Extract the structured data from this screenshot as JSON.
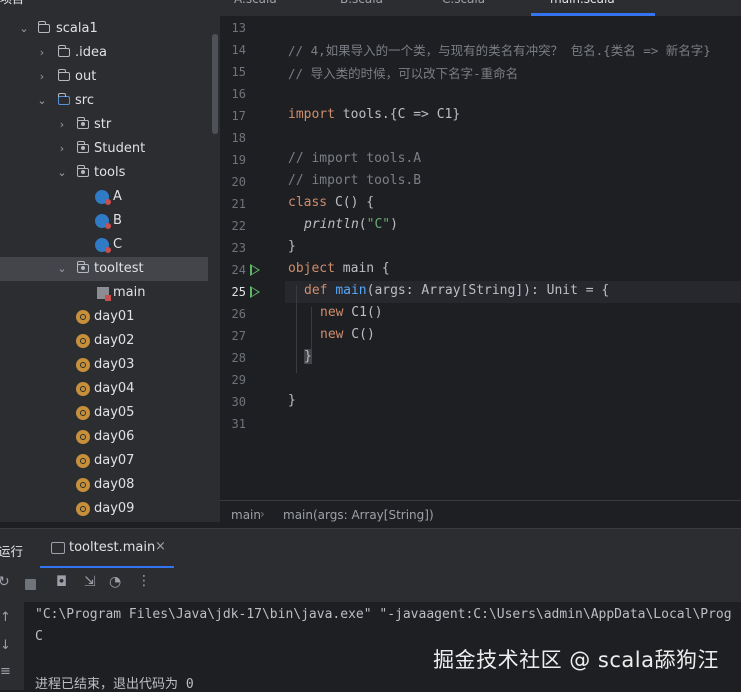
{
  "project_tree": {
    "header_partial": "项目",
    "items": [
      {
        "label": "scala1",
        "type": "folder",
        "expanded": true
      },
      {
        "label": ".idea",
        "type": "folder",
        "expanded": false
      },
      {
        "label": "out",
        "type": "folder",
        "expanded": false
      },
      {
        "label": "src",
        "type": "folder",
        "expanded": true
      },
      {
        "label": "str",
        "type": "package",
        "expanded": false
      },
      {
        "label": "Student",
        "type": "package",
        "expanded": false
      },
      {
        "label": "tools",
        "type": "package",
        "expanded": true
      },
      {
        "label": "A",
        "type": "scala-class"
      },
      {
        "label": "B",
        "type": "scala-class"
      },
      {
        "label": "C",
        "type": "scala-class"
      },
      {
        "label": "tooltest",
        "type": "package",
        "expanded": true
      },
      {
        "label": "main",
        "type": "scala-main"
      },
      {
        "label": "day01",
        "type": "object"
      },
      {
        "label": "day02",
        "type": "object"
      },
      {
        "label": "day03",
        "type": "object"
      },
      {
        "label": "day04",
        "type": "object"
      },
      {
        "label": "day05",
        "type": "object"
      },
      {
        "label": "day06",
        "type": "object"
      },
      {
        "label": "day07",
        "type": "object"
      },
      {
        "label": "day08",
        "type": "object"
      },
      {
        "label": "day09",
        "type": "object"
      }
    ]
  },
  "editor": {
    "tabs": [
      "A.scala",
      "B.scala",
      "C.scala",
      "main.scala"
    ],
    "active_tab": "main.scala",
    "line_numbers": [
      "13",
      "14",
      "15",
      "16",
      "17",
      "18",
      "19",
      "20",
      "21",
      "22",
      "23",
      "24",
      "25",
      "26",
      "27",
      "28",
      "29",
      "30",
      "31"
    ],
    "current_line": "25",
    "code": {
      "l14": "// 4,如果导入的一个类，与现有的类名有冲突？ 包名.{类名 => 新名字}",
      "l15": "// 导入类的时候，可以改下名字-重命名",
      "l17_kw": "import",
      "l17_rest": " tools.{C => C1}",
      "l19": "// import tools.A",
      "l20": "// import tools.B",
      "l21_kw": "class",
      "l21_rest": " C() {",
      "l22_fn": "println",
      "l22_open": "(",
      "l22_str": "\"C\"",
      "l22_close": ")",
      "l23": "}",
      "l24_kw": "object",
      "l24_rest": " main {",
      "l25_kw": "def",
      "l25_fn": "main",
      "l25_rest": "(args: Array[String]): Unit = {",
      "l26_kw": "new",
      "l26_rest": " C1()",
      "l27_kw": "new",
      "l27_rest": " C()",
      "l28": "}",
      "l30": "}"
    },
    "breadcrumb": [
      "main",
      "main(args: Array[String])"
    ]
  },
  "run_panel": {
    "title": "运行",
    "tab_label": "tooltest.main",
    "console_lines": [
      "\"C:\\Program Files\\Java\\jdk-17\\bin\\java.exe\" \"-javaagent:C:\\Users\\admin\\AppData\\Local\\Prog",
      "C",
      "",
      "进程已结束，退出代码为 0"
    ]
  },
  "watermark": "掘金技术社区 @ scala舔狗汪",
  "colors": {
    "accent": "#3574f0",
    "keyword": "#cf8e6d",
    "comment": "#7a7e85",
    "string": "#6aab73",
    "function": "#56a8f5",
    "run": "#5fb865"
  }
}
